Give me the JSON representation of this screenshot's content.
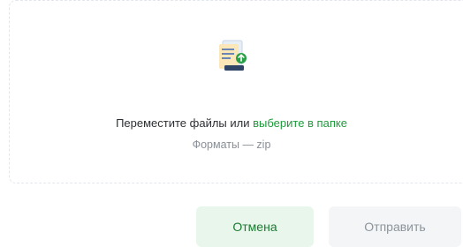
{
  "upload": {
    "drop_text": "Переместите файлы или ",
    "pick_link": "выберите в папке",
    "formats": "Форматы — zip"
  },
  "actions": {
    "cancel_label": "Отмена",
    "submit_label": "Отправить"
  },
  "colors": {
    "link": "#1e9b3b",
    "cancel_bg": "#e9f6ec",
    "submit_bg": "#f3f5f7"
  },
  "icons": {
    "upload": "file-upload-icon"
  }
}
